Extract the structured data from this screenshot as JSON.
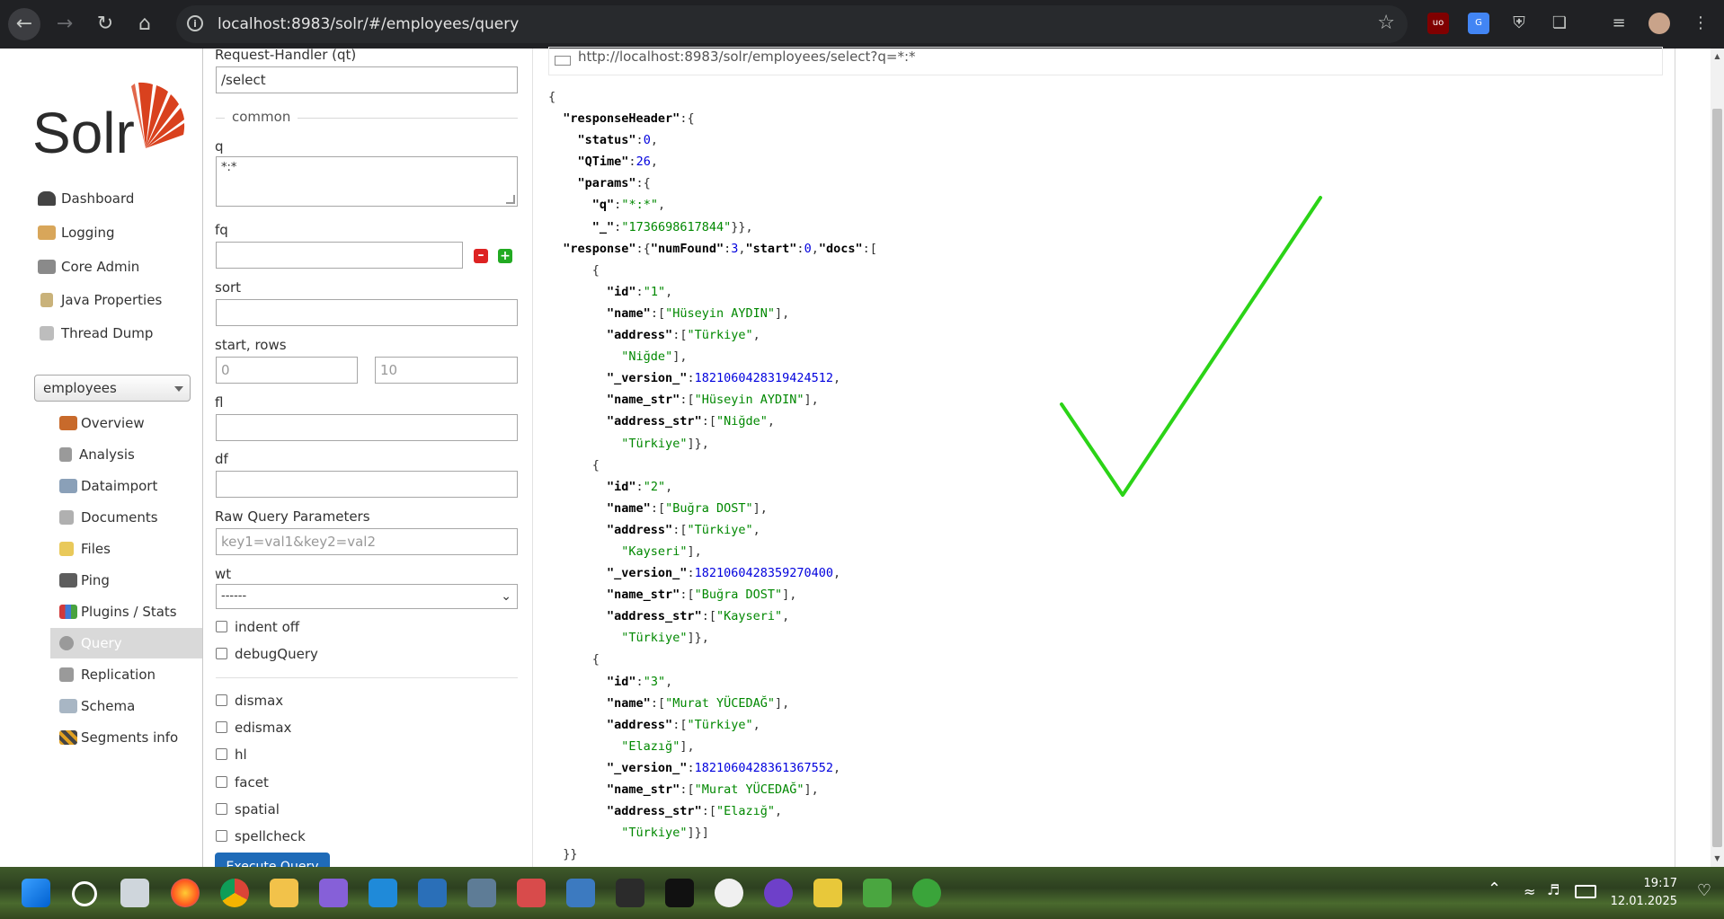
{
  "browser": {
    "url": "localhost:8983/solr/#/employees/query",
    "extensions": [
      "ublock-icon",
      "google-translate-icon",
      "shield-icon",
      "extensions-puzzle-icon",
      "media-queue-icon",
      "profile-avatar-icon",
      "kebab-menu-icon"
    ]
  },
  "sidebar": {
    "logo_text": "Solr",
    "menu": [
      "Dashboard",
      "Logging",
      "Core Admin",
      "Java Properties",
      "Thread Dump"
    ],
    "core_selector": "employees",
    "core_menu": [
      "Overview",
      "Analysis",
      "Dataimport",
      "Documents",
      "Files",
      "Ping",
      "Plugins / Stats",
      "Query",
      "Replication",
      "Schema",
      "Segments info"
    ],
    "active_core_menu": "Query"
  },
  "form": {
    "request_handler_label": "Request-Handler (qt)",
    "request_handler_value": "/select",
    "common_legend": "common",
    "q_label": "q",
    "q_value": "*:*",
    "fq_label": "fq",
    "sort_label": "sort",
    "start_rows_label": "start, rows",
    "start_placeholder": "0",
    "rows_placeholder": "10",
    "fl_label": "fl",
    "df_label": "df",
    "raw_label": "Raw Query Parameters",
    "raw_placeholder": "key1=val1&key2=val2",
    "wt_label": "wt",
    "wt_value": "------",
    "checkboxes": [
      "indent off",
      "debugQuery",
      "dismax",
      "edismax",
      "hl",
      "facet",
      "spatial",
      "spellcheck"
    ],
    "execute_label": "Execute Query"
  },
  "result": {
    "request_url": "http://localhost:8983/solr/employees/select?q=*:*",
    "status": 0,
    "qtime": 26,
    "params_q": "*:*",
    "params_underscore": "1736698617844",
    "num_found": 3,
    "start": 0,
    "docs": [
      {
        "id": "1",
        "name": "Hüseyin AYDIN",
        "address": [
          "Türkiye",
          "Niğde"
        ],
        "version": "1821060428319424512",
        "name_str": "Hüseyin AYDIN",
        "address_str": [
          "Niğde",
          "Türkiye"
        ]
      },
      {
        "id": "2",
        "name": "Buğra DOST",
        "address": [
          "Türkiye",
          "Kayseri"
        ],
        "version": "1821060428359270400",
        "name_str": "Buğra DOST",
        "address_str": [
          "Kayseri",
          "Türkiye"
        ]
      },
      {
        "id": "3",
        "name": "Murat YÜCEDAĞ",
        "address": [
          "Türkiye",
          "Elazığ"
        ],
        "version": "1821060428361367552",
        "name_str": "Murat YÜCEDAĞ",
        "address_str": [
          "Elazığ",
          "Türkiye"
        ]
      }
    ]
  },
  "taskbar": {
    "time": "19:17",
    "date": "12.01.2025"
  },
  "colors": {
    "solr_red": "#d9411e",
    "check_green": "#2bd317",
    "json_string": "#008800",
    "json_number": "#0000dd"
  }
}
